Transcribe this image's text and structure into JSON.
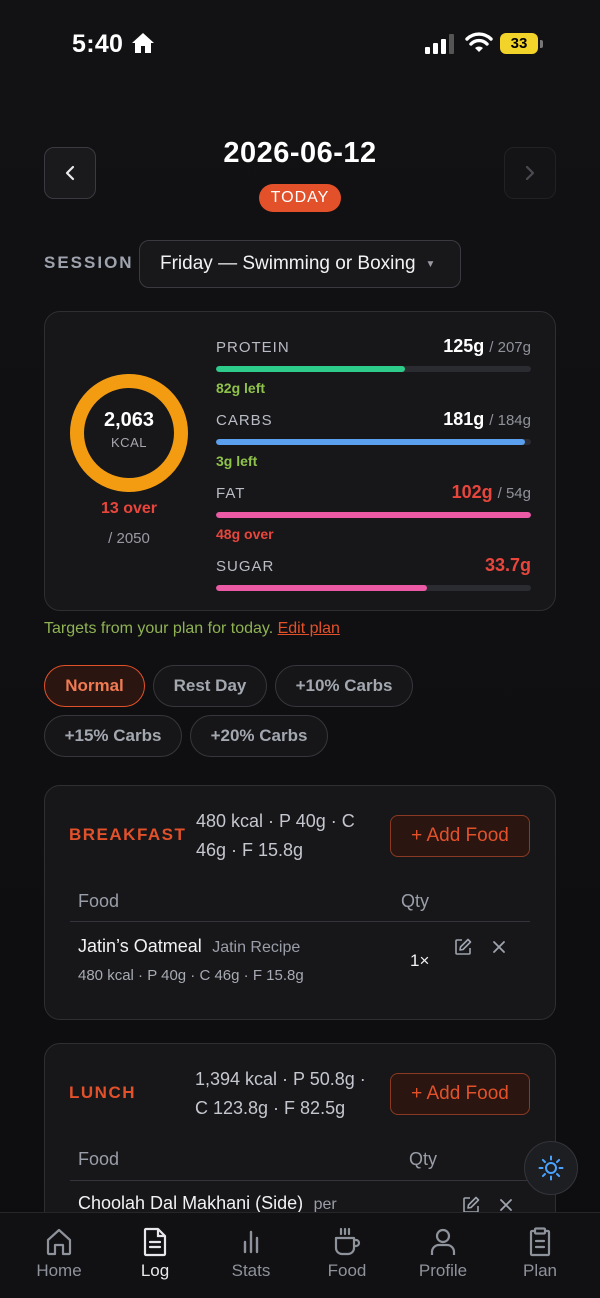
{
  "status_bar": {
    "time": "5:40",
    "battery": "33"
  },
  "header": {
    "date": "2026-06-12",
    "badge": "TODAY"
  },
  "session": {
    "label": "SESSION",
    "value": "Friday — Swimming or Boxing"
  },
  "summary": {
    "kcal_value": "2,063",
    "kcal_unit": "KCAL",
    "over_text": "13 over",
    "target_text": "/ 2050",
    "kcal_progress": 1.0,
    "ring_color": "#f39c12",
    "macros": [
      {
        "name": "PROTEIN",
        "value": "125g",
        "target": "/ 207g",
        "left": "82g left",
        "left_color": "#8fc24a",
        "value_color": "#ffffff",
        "bar_color": "#2ecc8a",
        "fill": 0.6
      },
      {
        "name": "CARBS",
        "value": "181g",
        "target": "/ 184g",
        "left": "3g left",
        "left_color": "#8fc24a",
        "value_color": "#ffffff",
        "bar_color": "#5aa0ef",
        "fill": 0.98
      },
      {
        "name": "FAT",
        "value": "102g",
        "target": "/ 54g",
        "left": "48g over",
        "left_color": "#e8463c",
        "value_color": "#e8463c",
        "bar_color": "#ec5aa6",
        "fill": 1.0
      },
      {
        "name": "SUGAR",
        "value": "33.7g",
        "target": "",
        "left": "",
        "left_color": "#8fc24a",
        "value_color": "#e8463c",
        "bar_color": "#ec5aa6",
        "fill": 0.67
      }
    ]
  },
  "targets_note": {
    "text": "Targets from your plan for today.",
    "link": "Edit plan"
  },
  "day_types": [
    "Normal",
    "Rest Day",
    "+10% Carbs",
    "+15% Carbs",
    "+20% Carbs"
  ],
  "meals": {
    "breakfast": {
      "title": "BREAKFAST",
      "summary_line1": "480 kcal · P 40g · C",
      "summary_line2": "46g · F 15.8g",
      "add_label": "+ Add Food",
      "col_food": "Food",
      "col_qty": "Qty",
      "items": [
        {
          "name": "Jatin’s Oatmeal",
          "source": "Jatin Recipe",
          "macros": "480 kcal · P 40g · C 46g · F 15.8g",
          "qty": "1×"
        }
      ]
    },
    "lunch": {
      "title": "LUNCH",
      "summary_line1": "1,394 kcal · P 50.8g ·",
      "summary_line2": "C 123.8g · F 82.5g",
      "add_label": "+ Add Food",
      "col_food": "Food",
      "col_qty": "Qty",
      "items": [
        {
          "name": "Choolah Dal Makhani (Side)",
          "source": "per"
        }
      ]
    }
  },
  "nav": [
    "Home",
    "Log",
    "Stats",
    "Food",
    "Profile",
    "Plan"
  ],
  "colors": {
    "accent": "#e2512a",
    "background": "#121214",
    "card": "#17171a"
  }
}
